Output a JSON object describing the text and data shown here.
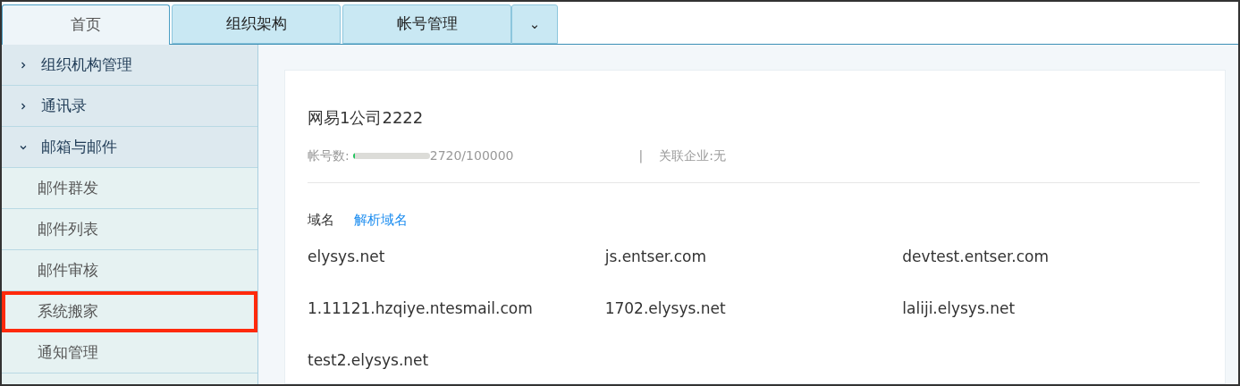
{
  "tabs": [
    {
      "label": "首页",
      "selected": true
    },
    {
      "label": "组织架构",
      "selected": false
    },
    {
      "label": "帐号管理",
      "selected": false
    }
  ],
  "tab_dropdown": {
    "label": "⌄"
  },
  "sidebar": {
    "items": [
      {
        "label": "组织机构管理",
        "expanded": false,
        "highlighted": false
      },
      {
        "label": "通讯录",
        "expanded": false,
        "highlighted": false
      },
      {
        "label": "邮箱与邮件",
        "expanded": true,
        "highlighted": false,
        "children": [
          {
            "label": "邮件群发",
            "highlighted": false
          },
          {
            "label": "邮件列表",
            "highlighted": false
          },
          {
            "label": "邮件审核",
            "highlighted": false
          },
          {
            "label": "系统搬家",
            "highlighted": true
          },
          {
            "label": "通知管理",
            "highlighted": false
          }
        ]
      }
    ]
  },
  "company": {
    "name": "网易1公司2222",
    "accounts_label": "帐号数:",
    "accounts_usage": {
      "level": 0.03
    },
    "accounts_count": "2720/100000",
    "separator": "|",
    "linked_label": "关联企业:无"
  },
  "domains": {
    "label": "域名",
    "link": "解析域名",
    "items": [
      "elysys.net",
      "js.entser.com",
      "devtest.entser.com",
      "1.11121.hzqiye.ntesmail.com",
      "1702.elysys.net",
      "laliji.elysys.net",
      "test2.elysys.net"
    ]
  }
}
